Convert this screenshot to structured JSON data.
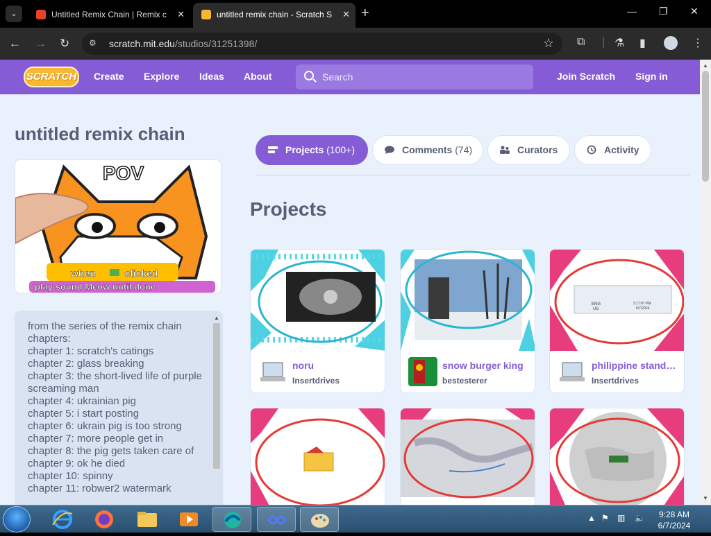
{
  "browser": {
    "tabs": [
      {
        "title": "Untitled Remix Chain | Remix c",
        "active": false
      },
      {
        "title": "untitled remix chain - Scratch S",
        "active": true
      }
    ],
    "url_host": "scratch.mit.edu",
    "url_path": "/studios/31251398/"
  },
  "header": {
    "logo_text": "SCRATCH",
    "links": [
      "Create",
      "Explore",
      "Ideas",
      "About"
    ],
    "search_placeholder": "Search",
    "join": "Join Scratch",
    "signin": "Sign in"
  },
  "studio": {
    "title": "untitled remix chain",
    "thumbnail_text": {
      "top": "POV",
      "when": "when",
      "clicked": "clicked",
      "play": "play sound Meow until done"
    },
    "description": [
      "from the series of the remix chain",
      "chapters:",
      "chapter 1: scratch's catings",
      "chapter 2: glass breaking",
      "chapter 3: the short-lived life of purple screaming man",
      "chapter 4: ukrainian pig",
      "chapter 5: i start posting",
      "chapter 6: ukrain pig is too strong",
      "chapter 7: more people get in",
      "chapter 8: the pig gets taken care of",
      "chapter 9: ok he died",
      "chapter 10: spinny",
      "chapter 11: robwer2 watermark"
    ]
  },
  "tabs": [
    {
      "label": "Projects",
      "count": "(100+)",
      "active": true
    },
    {
      "label": "Comments",
      "count": "(74)",
      "active": false
    },
    {
      "label": "Curators",
      "count": "",
      "active": false
    },
    {
      "label": "Activity",
      "count": "",
      "active": false
    }
  ],
  "projects_heading": "Projects",
  "projects": [
    {
      "title": "noru",
      "owner": "Insertdrives"
    },
    {
      "title": "snow burger king",
      "owner": "bestesterer"
    },
    {
      "title": "philippine standard time",
      "owner": "Insertdrives"
    },
    {
      "title": "",
      "owner": ""
    },
    {
      "title": "",
      "owner": ""
    },
    {
      "title": "",
      "owner": ""
    }
  ],
  "card3_screen": {
    "lang1": "ENG",
    "lang2": "US",
    "time": "2:17:07 PM",
    "date": "6/7/2024"
  },
  "taskbar": {
    "time": "9:28 AM",
    "date": "6/7/2024"
  },
  "colors": {
    "scratch_purple": "#855cd6",
    "page_bg": "#e9f1fc",
    "text": "#575e75"
  }
}
